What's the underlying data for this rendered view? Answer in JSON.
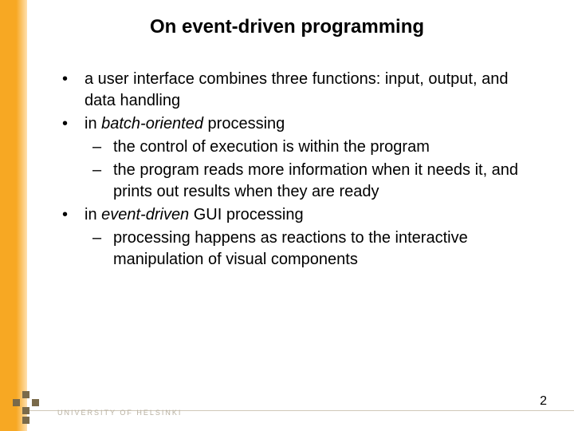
{
  "title": "On event-driven programming",
  "bullets": {
    "b1": "a user interface combines three functions: input, output, and data handling",
    "b2_pre": "in ",
    "b2_em": "batch-oriented",
    "b2_post": " processing",
    "b2_s1": "the control of execution is within the program",
    "b2_s2": "the program reads more information when it needs it, and prints out results when they are ready",
    "b3_pre": "in ",
    "b3_em": "event-driven",
    "b3_post": " GUI processing",
    "b3_s1": "processing happens as reactions to the interactive manipulation of visual components"
  },
  "footer": {
    "university": "UNIVERSITY OF HELSINKI",
    "page": "2"
  }
}
